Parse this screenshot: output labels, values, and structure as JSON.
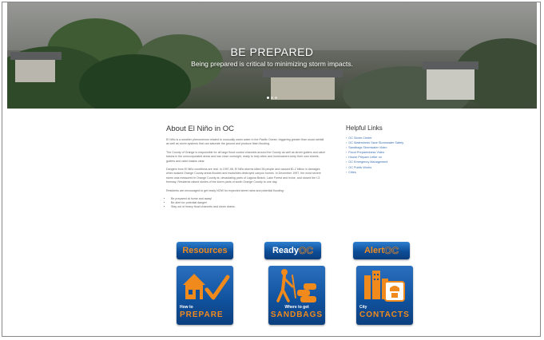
{
  "hero": {
    "title": "BE PREPARED",
    "subtitle": "Being prepared is critical to minimizing storm impacts.",
    "slides": 3,
    "active_slide": 1
  },
  "about": {
    "heading": "About El Niño in OC",
    "paragraphs": [
      "El Niño is a weather phenomenon related to unusually warm water in the Pacific Ocean, triggering greater than usual rainfall as well as storm systems that can saturate the ground and produce flash flooding.",
      "The County of Orange is responsible for all large flood control channels around the County as well as street gutters and catch basins in the unincorporated areas and has close oversight, ready to help cities and homeowners keep their own streets, gutters and catch basins clear.",
      "Dangers from El Niño conditions are real. In 1997-98, El Niño storms killed 36 people and caused $1.2 billion in damages when soaked Orange County areas flooded and mudslides destroyed canyon homes. In December 1997, the most severe storm was measured in Orange County at, devastating parts of Laguna Beach, Lake Forest and Irvine, and closed the I-5 freeway. Residents raised stories of the storm parts of south Orange County to one day.",
      "Residents are encouraged to get ready NOW for expected street rains and potential flooding:"
    ],
    "bullets": [
      "Be prepared at home and away!",
      "Be alert for potential danger!",
      "Stay out of heavy flood channels and storm drains."
    ]
  },
  "links": {
    "heading": "Helpful Links",
    "items": [
      "OC Storm Center",
      "OC Watersheds Save Stormwater Safety",
      "Sandbags Stormwater Video",
      "Flood Preparedness Video",
      "House Prepare Letter on",
      "OC Emergency Management",
      "OC Public Works",
      "Cities"
    ]
  },
  "tiles": {
    "resources": "Resources",
    "readyoc_a": "Ready",
    "readyoc_b": "OC",
    "alertoc_a": "Alert",
    "alertoc_b": "OC",
    "prepare_small": "How to",
    "prepare_big": "PREPARE",
    "sandbags_small": "Where to get",
    "sandbags_big": "SANDBAGS",
    "contacts_small": "City",
    "contacts_big": "CONTACTS"
  },
  "colors": {
    "tile_blue": "#0d4d98",
    "accent_orange": "#f08a1c",
    "link_blue": "#3a6fb0"
  }
}
